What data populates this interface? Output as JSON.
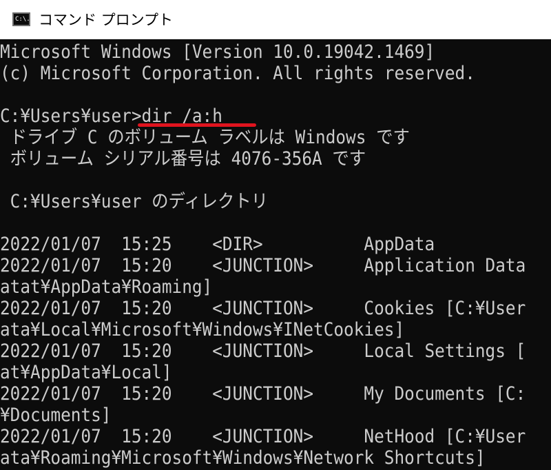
{
  "window": {
    "title": "コマンド プロンプト",
    "icon_label": "C:\\."
  },
  "console": {
    "lines": [
      "Microsoft Windows [Version 10.0.19042.1469]",
      "(c) Microsoft Corporation. All rights reserved.",
      "",
      "C:¥Users¥user>dir /a:h",
      " ドライブ C のボリューム ラベルは Windows です",
      " ボリューム シリアル番号は 4076-356A です",
      "",
      " C:¥Users¥user のディレクトリ",
      "",
      "2022/01/07  15:25    <DIR>          AppData",
      "2022/01/07  15:20    <JUNCTION>     Application Data",
      "atat¥AppData¥Roaming]",
      "2022/01/07  15:20    <JUNCTION>     Cookies [C:¥User",
      "ata¥Local¥Microsoft¥Windows¥INetCookies]",
      "2022/01/07  15:20    <JUNCTION>     Local Settings [",
      "at¥AppData¥Local]",
      "2022/01/07  15:20    <JUNCTION>     My Documents [C:",
      "¥Documents]",
      "2022/01/07  15:20    <JUNCTION>     NetHood [C:¥User",
      "ata¥Roaming¥Microsoft¥Windows¥Network Shortcuts]"
    ]
  },
  "colors": {
    "console_bg": "#0c0c0c",
    "console_text": "#cccccc",
    "highlight": "#e0141e"
  }
}
